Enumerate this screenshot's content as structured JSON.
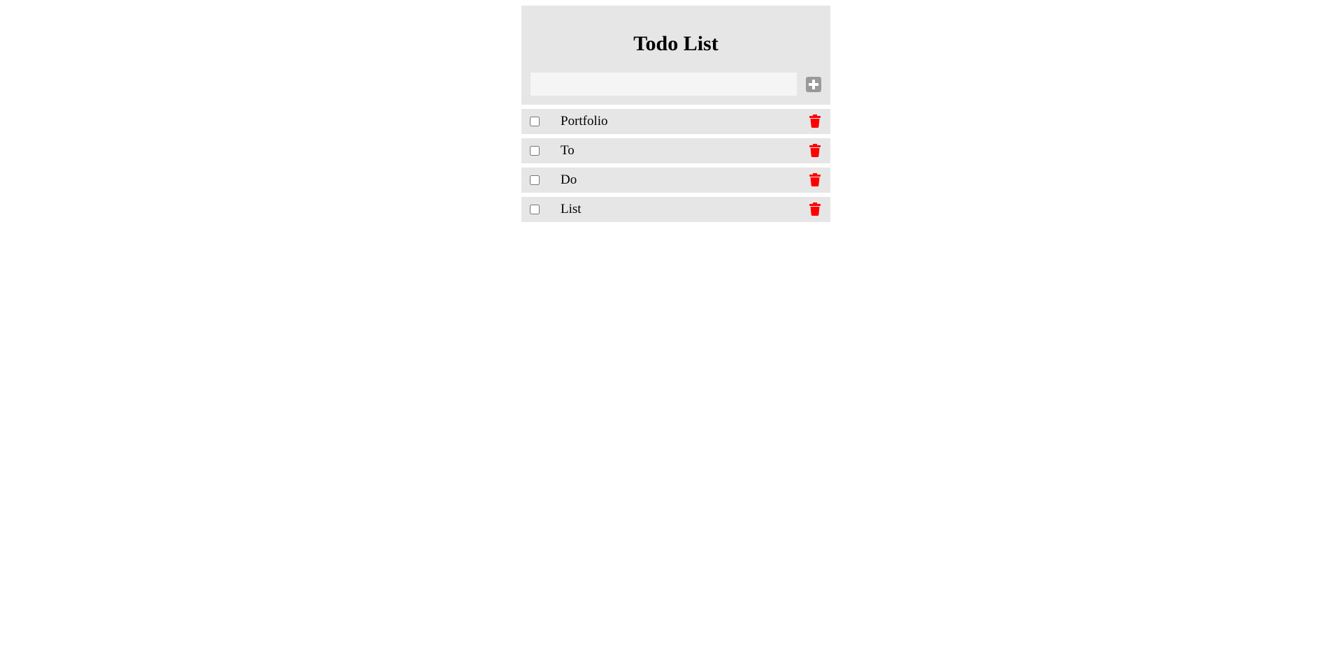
{
  "header": {
    "title": "Todo List",
    "input_placeholder": "",
    "input_value": "",
    "add_icon": "plus-square-icon",
    "add_icon_color": "#999999"
  },
  "todos": [
    {
      "label": "Portfolio",
      "checked": false
    },
    {
      "label": "To",
      "checked": false
    },
    {
      "label": "Do",
      "checked": false
    },
    {
      "label": "List",
      "checked": false
    }
  ],
  "delete_icon": "trash-icon",
  "delete_icon_color": "#ff0000"
}
